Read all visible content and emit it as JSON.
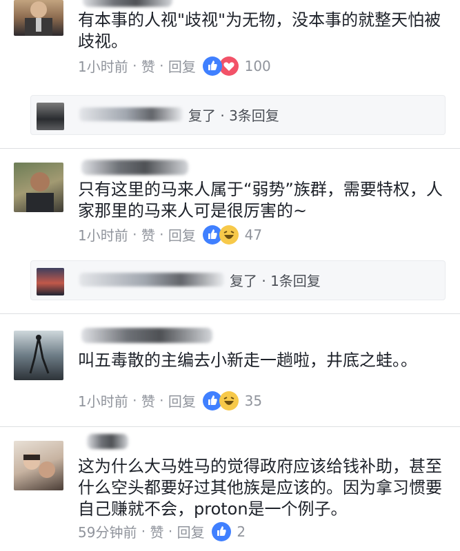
{
  "comments": [
    {
      "text": "有本事的人视\"歧视\"为无物，没本事的就整天怕被歧视。",
      "time": "1小时前",
      "like": "赞",
      "reply": "回复",
      "reactions": [
        "like-icon",
        "love-icon"
      ],
      "count": "100",
      "reply_summary": "复了 · 3条回复"
    },
    {
      "text": "只有这里的马来人属于“弱势”族群，需要特权，人家那里的马来人可是很厉害的~",
      "time": "1小时前",
      "like": "赞",
      "reply": "回复",
      "reactions": [
        "like-icon",
        "haha-icon"
      ],
      "count": "47",
      "reply_summary": "复了 · 1条回复"
    },
    {
      "text": "叫五毒散的主编去小新走一趟啦，井底之蛙。。",
      "time": "1小时前",
      "like": "赞",
      "reply": "回复",
      "reactions": [
        "like-icon",
        "haha-icon"
      ],
      "count": "35"
    },
    {
      "text": "这为什么大马姓马的觉得政府应该给钱补助，甚至什么空头都要好过其他族是应该的。因为拿习惯要自己赚就不会，proton是一个例子。",
      "time": "59分钟前",
      "like": "赞",
      "reply": "回复",
      "reactions": [
        "like-icon"
      ],
      "count": "2"
    }
  ],
  "separator": " · ",
  "colors": {
    "like": "#4080ff",
    "love": "#f25268",
    "haha": "#f7c94a",
    "meta": "#90949c"
  }
}
